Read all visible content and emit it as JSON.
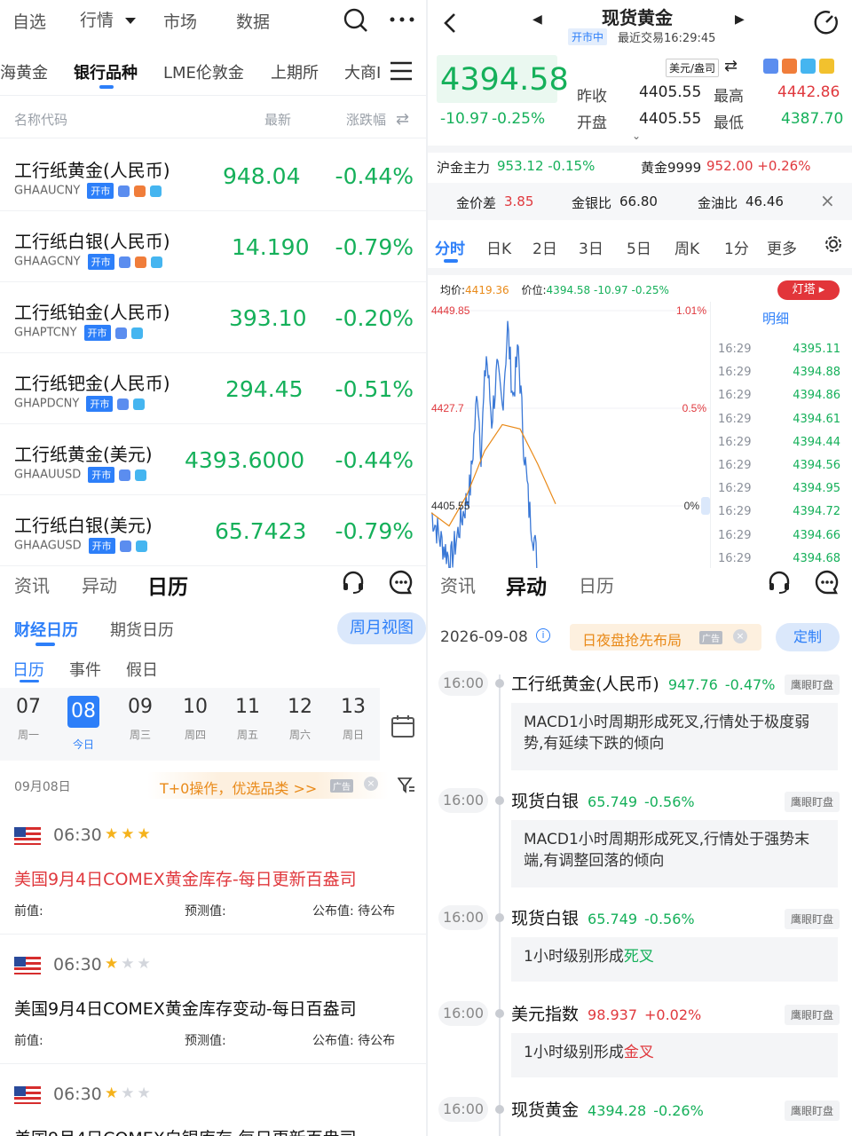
{
  "left": {
    "topnav": {
      "items": [
        "自选",
        "行情",
        "市场",
        "数据"
      ],
      "active_index": 1
    },
    "subnav": {
      "items": [
        "海黄金",
        "银行品种",
        "LME伦敦金",
        "上期所",
        "大商I"
      ],
      "active_index": 1
    },
    "columns": {
      "name": "名称代码",
      "last": "最新",
      "change": "涨跌幅"
    },
    "open_tag": "开市",
    "quotes": [
      {
        "name": "工行纸黄金(人民币)",
        "code": "GHAAUCNY",
        "last": "948.04",
        "change": "-0.44%"
      },
      {
        "name": "工行纸白银(人民币)",
        "code": "GHAAGCNY",
        "last": "14.190",
        "change": "-0.79%"
      },
      {
        "name": "工行纸铂金(人民币)",
        "code": "GHAPTCNY",
        "last": "393.10",
        "change": "-0.20%"
      },
      {
        "name": "工行纸钯金(人民币)",
        "code": "GHAPDCNY",
        "last": "294.45",
        "change": "-0.51%"
      },
      {
        "name": "工行纸黄金(美元)",
        "code": "GHAAUUSD",
        "last": "4393.6000",
        "change": "-0.44%"
      },
      {
        "name": "工行纸白银(美元)",
        "code": "GHAAGUSD",
        "last": "65.7423",
        "change": "-0.79%"
      }
    ],
    "bottom_tabs": [
      "资讯",
      "异动",
      "日历"
    ],
    "bottom_active": 2,
    "cal_tabs": [
      "财经日历",
      "期货日历"
    ],
    "week_view_btn": "周月视图",
    "cal_subtabs": [
      "日历",
      "事件",
      "假日"
    ],
    "days": [
      {
        "d": "07",
        "w": "周一"
      },
      {
        "d": "08",
        "w": "今日"
      },
      {
        "d": "09",
        "w": "周三"
      },
      {
        "d": "10",
        "w": "周四"
      },
      {
        "d": "11",
        "w": "周五"
      },
      {
        "d": "12",
        "w": "周六"
      },
      {
        "d": "13",
        "w": "周日"
      }
    ],
    "date_label": "09月08日",
    "ad_text": "T+0操作，优选品类 >>",
    "ad_tag": "广告",
    "events": [
      {
        "time": "06:30",
        "stars": 3,
        "title": "美国9月4日COMEX黄金库存-每日更新百盎司",
        "prev": "前值:",
        "forecast": "预测值:",
        "actual": "公布值: 待公布",
        "highlight": true
      },
      {
        "time": "06:30",
        "stars": 1,
        "title": "美国9月4日COMEX黄金库存变动-每日百盎司",
        "prev": "前值:",
        "forecast": "预测值:",
        "actual": "公布值: 待公布",
        "highlight": false
      },
      {
        "time": "06:30",
        "stars": 1,
        "title": "美国9月4日COMEX白银库存-每日更新百盎司",
        "highlight": false
      }
    ]
  },
  "right": {
    "title": "现货黄金",
    "status": "开市中",
    "last_trade": "最近交易16:29:45",
    "price": "4394.58",
    "change": "-10.97",
    "change_pct": "-0.25%",
    "unit": "美元/盎司",
    "prev_close_label": "昨收",
    "prev_close": "4405.55",
    "open_label": "开盘",
    "open": "4405.55",
    "high_label": "最高",
    "high": "4442.86",
    "low_label": "最低",
    "low": "4387.70",
    "strip1": {
      "a_label": "沪金主力",
      "a_value": "953.12 -0.15%",
      "b_label": "黄金9999",
      "b_value": "952.00 +0.26%"
    },
    "strip2": {
      "a_label": "金价差",
      "a_value": "3.85",
      "b_label": "金银比",
      "b_value": "66.80",
      "c_label": "金油比",
      "c_value": "46.46"
    },
    "ktabs": [
      "分时",
      "日K",
      "2日",
      "3日",
      "5日",
      "周K",
      "1分",
      "更多"
    ],
    "ktab_active": 0,
    "avg_label": "均价:",
    "avg_value": "4419.36",
    "price_label": "价位:",
    "price_value": "4394.58 -10.97 -0.25%",
    "lighthouse": "灯塔",
    "chart_axis": {
      "y_top": "4449.85",
      "y_mid": "4427.7",
      "y_base": "4405.55",
      "pct_top": "1.01%",
      "pct_mid": "0.5%",
      "pct_base": "0%"
    },
    "detail_title": "明细",
    "details": [
      {
        "t": "16:29",
        "v": "4395.11"
      },
      {
        "t": "16:29",
        "v": "4394.88"
      },
      {
        "t": "16:29",
        "v": "4394.86"
      },
      {
        "t": "16:29",
        "v": "4394.61"
      },
      {
        "t": "16:29",
        "v": "4394.44"
      },
      {
        "t": "16:29",
        "v": "4394.56"
      },
      {
        "t": "16:29",
        "v": "4394.95"
      },
      {
        "t": "16:29",
        "v": "4394.72"
      },
      {
        "t": "16:29",
        "v": "4394.66"
      },
      {
        "t": "16:29",
        "v": "4394.68"
      }
    ],
    "bottom_tabs": [
      "资讯",
      "异动",
      "日历"
    ],
    "bottom_active": 1,
    "date": "2026-09-08",
    "ad_text": "日夜盘抢先布局",
    "ad_tag": "广告",
    "custom_btn": "定制",
    "timeline": [
      {
        "time": "16:00",
        "name": "工行纸黄金(人民币)",
        "value": "947.76",
        "pct": "-0.47%",
        "color": "green",
        "badge": "鹰眼盯盘",
        "text": "MACD1小时周期形成死叉,行情处于极度弱势,有延续下跌的倾向",
        "kw": ""
      },
      {
        "time": "16:00",
        "name": "现货白银",
        "value": "65.749",
        "pct": "-0.56%",
        "color": "green",
        "badge": "鹰眼盯盘",
        "text": "MACD1小时周期形成死叉,行情处于强势末端,有调整回落的倾向",
        "kw": ""
      },
      {
        "time": "16:00",
        "name": "现货白银",
        "value": "65.749",
        "pct": "-0.56%",
        "color": "green",
        "badge": "鹰眼盯盘",
        "text": "1小时级别形成",
        "kw": "死叉",
        "kwcolor": "green"
      },
      {
        "time": "16:00",
        "name": "美元指数",
        "value": "98.937",
        "pct": "+0.02%",
        "color": "red",
        "badge": "鹰眼盯盘",
        "text": "1小时级别形成",
        "kw": "金叉",
        "kwcolor": "red"
      },
      {
        "time": "16:00",
        "name": "现货黄金",
        "value": "4394.28",
        "pct": "-0.26%",
        "color": "green",
        "badge": "鹰眼盯盘"
      }
    ]
  }
}
